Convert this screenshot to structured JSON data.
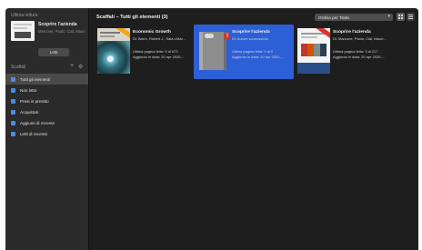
{
  "sidebar": {
    "recent_header": "Ultima lettura",
    "recent": {
      "title": "Scoprire l'azienda",
      "author": "Marcone, Paolo; Cial, Mauri...",
      "read_button": "Letti"
    },
    "shelves_label": "Scaffali",
    "add_symbol": "+",
    "gear_symbol": "⚙",
    "items": [
      {
        "label": "Tutti gli elementi",
        "selected": true
      },
      {
        "label": "Non letto",
        "selected": false
      },
      {
        "label": "Presi in prestito",
        "selected": false
      },
      {
        "label": "Acquistati",
        "selected": false
      },
      {
        "label": "Aggiunti di recente",
        "selected": false
      },
      {
        "label": "Letti di recente",
        "selected": false
      }
    ]
  },
  "main": {
    "title": "Scaffali – Tutti gli elementi (3)",
    "sort_label": "Ordina per Titolo",
    "sort_chevron": "▾",
    "books": [
      {
        "title": "Economic Growth",
        "author": "Di: Barro, Robert J., Sala-i-Mar...",
        "page": "Ultima pagina letta: 5 di 673",
        "added": "Aggiunto in data: 20 apr 2020,...",
        "selected": false
      },
      {
        "title": "Scoprire l'azienda",
        "author": "Di: Autore sconosciuto",
        "page": "Ultima pagina letta: 0 di 0",
        "added": "Aggiunto in data: 20 apr 2020,...",
        "badge": "!",
        "selected": true
      },
      {
        "title": "Scoprire l'azienda",
        "author": "Di: Marcone, Paolo; Cial, Mauri...",
        "page": "Ultima pagina letta: 3 di 217",
        "added": "Aggiunto in data: 20 apr 2020,...",
        "selected": false
      }
    ]
  },
  "colors": {
    "accent": "#2d5fd6",
    "badge": "#d8322a",
    "nav_icon": "#4a8de0"
  }
}
